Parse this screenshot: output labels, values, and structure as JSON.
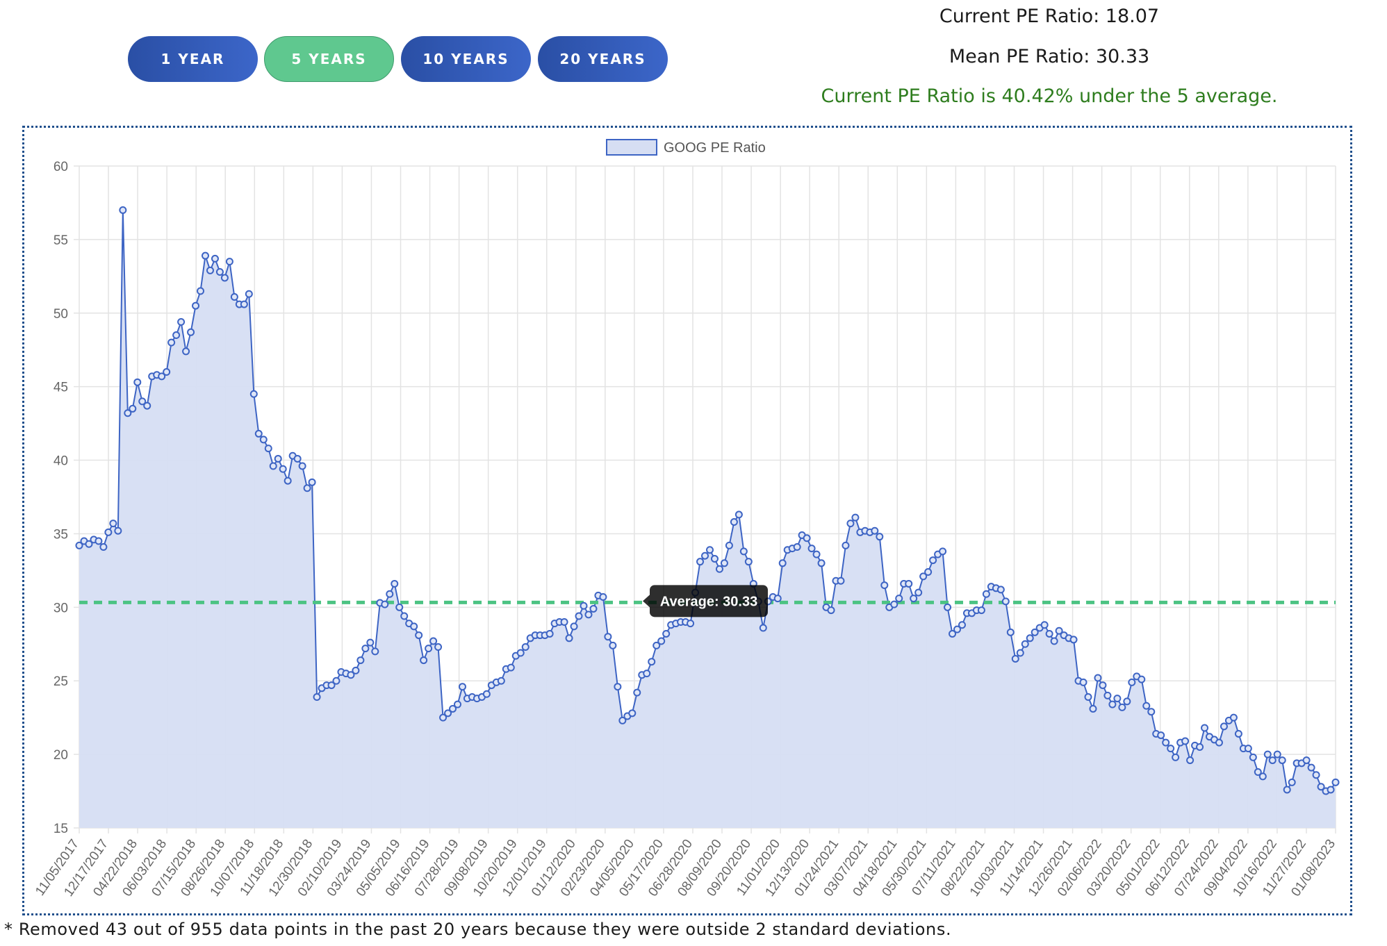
{
  "range_buttons": [
    {
      "label": "1 YEAR",
      "active": false
    },
    {
      "label": "5 YEARS",
      "active": true
    },
    {
      "label": "10 YEARS",
      "active": false
    },
    {
      "label": "20 YEARS",
      "active": false
    }
  ],
  "stats": {
    "current_pe_text": "Current PE Ratio: 18.07",
    "mean_pe_text": "Mean PE Ratio: 30.33",
    "comparison_text": "Current PE Ratio is 40.42% under the 5 average."
  },
  "footnote": "* Removed 43 out of 955 data points in the past 20 years because they were outside 2 standard deviations.",
  "colors": {
    "line": "#3d64c4",
    "fill": "#d6def3",
    "average": "#4cc383",
    "button": "#2f57b4",
    "button_active": "#5fc88f",
    "comparison_text": "#2e7d1e"
  },
  "chart_data": {
    "type": "area",
    "legend_label": "GOOG PE Ratio",
    "legend_position": "top-center",
    "grid": true,
    "ylim": [
      15,
      60
    ],
    "y_ticks": [
      "15",
      "20",
      "25",
      "30",
      "35",
      "40",
      "45",
      "50",
      "55",
      "60"
    ],
    "x_tick_labels": [
      "11/05/2017",
      "12/17/2017",
      "04/22/2018",
      "06/03/2018",
      "07/15/2018",
      "08/26/2018",
      "10/07/2018",
      "11/18/2018",
      "12/30/2018",
      "02/10/2019",
      "03/24/2019",
      "05/05/2019",
      "06/16/2019",
      "07/28/2019",
      "09/08/2019",
      "10/20/2019",
      "12/01/2019",
      "01/12/2020",
      "02/23/2020",
      "04/05/2020",
      "05/17/2020",
      "06/28/2020",
      "08/09/2020",
      "09/20/2020",
      "11/01/2020",
      "12/13/2020",
      "01/24/2021",
      "03/07/2021",
      "04/18/2021",
      "05/30/2021",
      "07/11/2021",
      "08/22/2021",
      "10/03/2021",
      "11/14/2021",
      "12/26/2021",
      "02/06/2022",
      "03/20/2022",
      "05/01/2022",
      "06/12/2022",
      "07/24/2022",
      "09/04/2022",
      "10/16/2022",
      "11/27/2022",
      "01/08/2023"
    ],
    "average": {
      "value": 30.33,
      "label": "Average: 30.33"
    },
    "series": [
      {
        "name": "GOOG PE Ratio",
        "values": [
          34.2,
          34.5,
          34.3,
          34.6,
          34.5,
          34.1,
          35.1,
          35.7,
          35.2,
          57.0,
          43.2,
          43.5,
          45.3,
          44.0,
          43.7,
          45.7,
          45.8,
          45.7,
          46.0,
          48.0,
          48.5,
          49.4,
          47.4,
          48.7,
          50.5,
          51.5,
          53.9,
          52.9,
          53.7,
          52.8,
          52.4,
          53.5,
          51.1,
          50.6,
          50.6,
          51.3,
          44.5,
          41.8,
          41.4,
          40.8,
          39.6,
          40.1,
          39.4,
          38.6,
          40.3,
          40.1,
          39.6,
          38.1,
          38.5,
          23.9,
          24.5,
          24.7,
          24.7,
          25.0,
          25.6,
          25.5,
          25.4,
          25.7,
          26.4,
          27.2,
          27.6,
          27.0,
          30.3,
          30.2,
          30.9,
          31.6,
          30.0,
          29.4,
          28.9,
          28.7,
          28.1,
          26.4,
          27.2,
          27.7,
          27.3,
          22.5,
          22.8,
          23.1,
          23.4,
          24.6,
          23.8,
          23.9,
          23.8,
          23.9,
          24.1,
          24.7,
          24.9,
          25.0,
          25.8,
          25.9,
          26.7,
          26.9,
          27.3,
          27.9,
          28.1,
          28.1,
          28.1,
          28.2,
          28.9,
          29.0,
          29.0,
          27.9,
          28.7,
          29.4,
          30.1,
          29.5,
          29.9,
          30.8,
          30.7,
          28.0,
          27.4,
          24.6,
          22.3,
          22.6,
          22.8,
          24.2,
          25.4,
          25.5,
          26.3,
          27.4,
          27.7,
          28.2,
          28.8,
          28.9,
          29.0,
          29.0,
          28.9,
          31.0,
          33.1,
          33.5,
          33.9,
          33.3,
          32.6,
          33.0,
          34.2,
          35.8,
          36.3,
          33.8,
          33.1,
          31.6,
          30.4,
          28.6,
          30.4,
          30.7,
          30.6,
          33.0,
          33.9,
          34.0,
          34.1,
          34.9,
          34.7,
          34.0,
          33.6,
          33.0,
          30.0,
          29.8,
          31.8,
          31.8,
          34.2,
          35.7,
          36.1,
          35.1,
          35.2,
          35.1,
          35.2,
          34.8,
          31.5,
          30.0,
          30.2,
          30.6,
          31.6,
          31.6,
          30.6,
          31.0,
          32.1,
          32.4,
          33.2,
          33.6,
          33.8,
          30.0,
          28.2,
          28.5,
          28.8,
          29.6,
          29.6,
          29.8,
          29.8,
          30.9,
          31.4,
          31.3,
          31.2,
          30.4,
          28.3,
          26.5,
          26.9,
          27.5,
          27.9,
          28.3,
          28.6,
          28.8,
          28.2,
          27.7,
          28.4,
          28.1,
          27.9,
          27.8,
          25.0,
          24.9,
          23.9,
          23.1,
          25.2,
          24.7,
          24.0,
          23.4,
          23.8,
          23.2,
          23.6,
          24.9,
          25.3,
          25.1,
          23.3,
          22.9,
          21.4,
          21.3,
          20.8,
          20.4,
          19.8,
          20.8,
          20.9,
          19.6,
          20.6,
          20.5,
          21.8,
          21.2,
          21.0,
          20.8,
          21.9,
          22.3,
          22.5,
          21.4,
          20.4,
          20.4,
          19.8,
          18.8,
          18.5,
          20.0,
          19.6,
          20.0,
          19.6,
          17.6,
          18.1,
          19.4,
          19.4,
          19.6,
          19.1,
          18.6,
          17.8,
          17.5,
          17.6,
          18.1
        ]
      }
    ]
  }
}
